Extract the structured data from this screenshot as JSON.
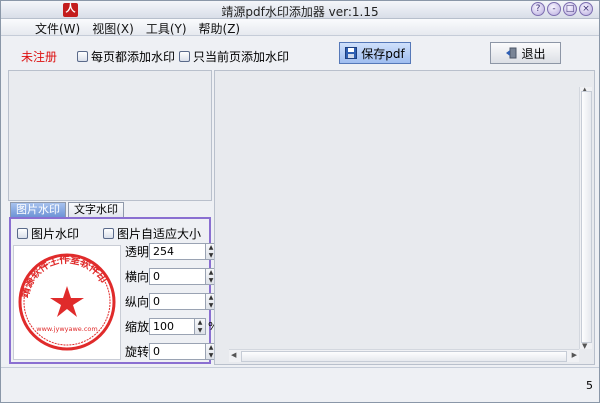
{
  "window": {
    "title": "靖源pdf水印添加器 ver:1.15",
    "app_icon_glyph": "人",
    "buttons": [
      "?",
      "-",
      "□",
      "×"
    ]
  },
  "menu": [
    {
      "label": "文件(W)"
    },
    {
      "label": "视图(X)"
    },
    {
      "label": "工具(Y)"
    },
    {
      "label": "帮助(Z)"
    }
  ],
  "toolbar": {
    "unregistered": "未注册",
    "each_page": "每页都添加水印",
    "current_page": "只当前页添加水印",
    "save_label": "保存pdf",
    "exit_label": "退出"
  },
  "tabs": [
    {
      "label": "图片水印",
      "active": true
    },
    {
      "label": "文字水印",
      "active": false
    }
  ],
  "watermark_panel": {
    "image_watermark": "图片水印",
    "auto_fit": "图片自适应大小",
    "stamp_top_text": "靖源软件工作室软件印",
    "stamp_bottom_text": "www.jywyawe.com",
    "fields": [
      {
        "label": "透明",
        "value": "254",
        "unit": ""
      },
      {
        "label": "横向",
        "value": "0",
        "unit": ""
      },
      {
        "label": "纵向",
        "value": "0",
        "unit": ""
      },
      {
        "label": "缩放",
        "value": "100",
        "unit": "%"
      },
      {
        "label": "旋转",
        "value": "0",
        "unit": ""
      }
    ]
  },
  "status": {
    "right_value": "5"
  },
  "colors": {
    "accent": "#8a6fd1",
    "unregistered": "#dd1111",
    "stamp": "#e02b2b"
  }
}
